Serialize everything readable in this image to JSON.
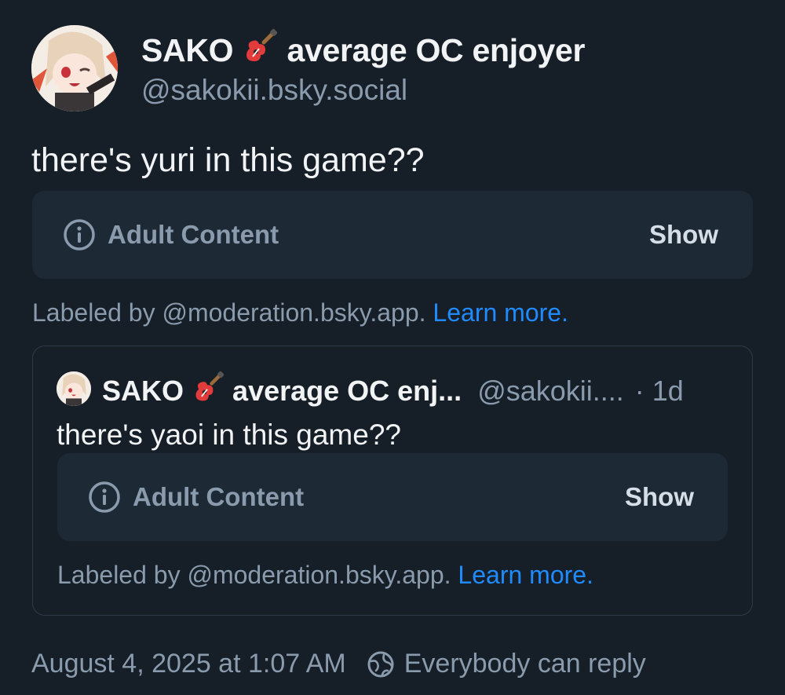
{
  "post": {
    "display_name_prefix": "SAKO",
    "display_name_suffix": "average OC enjoyer",
    "handle": "@sakokii.bsky.social",
    "text": "there's yuri in this game??",
    "warning": {
      "label": "Adult Content",
      "action": "Show"
    },
    "labeled_by": "Labeled by @moderation.bsky.app.",
    "learn_more": "Learn more."
  },
  "quote": {
    "display_name_prefix": "SAKO",
    "display_name_suffix": "average OC enj...",
    "handle": "@sakokii....",
    "time": "· 1d",
    "text": "there's yaoi in this game??",
    "warning": {
      "label": "Adult Content",
      "action": "Show"
    },
    "labeled_by": "Labeled by @moderation.bsky.app.",
    "learn_more": "Learn more."
  },
  "footer": {
    "timestamp": "August 4, 2025 at 1:07 AM",
    "reply_setting": "Everybody can reply"
  },
  "colors": {
    "background": "#161e27",
    "card": "#1e2936",
    "muted_text": "#8a9bad",
    "link": "#208bfe"
  },
  "icons": [
    "avatar",
    "guitar-icon",
    "info-icon",
    "globe-icon"
  ]
}
